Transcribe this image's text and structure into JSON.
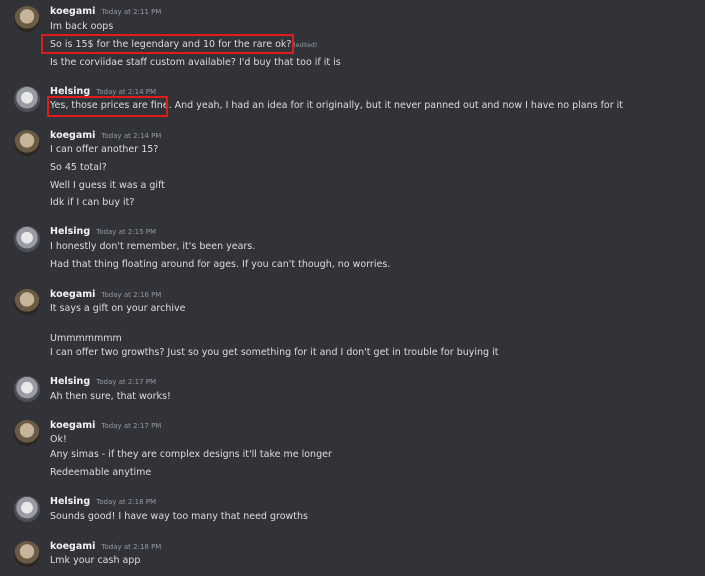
{
  "messages": [
    {
      "author": "koegami",
      "time": "Today at 2:11 PM",
      "lines": [
        "Im back oops",
        "So is 15$ for the legendary and 10 for the rare ok?",
        "Is the corviidae staff custom available? I'd buy that too if it is"
      ],
      "edited_label": "(edited)"
    },
    {
      "author": "Helsing",
      "time": "Today at 2:14 PM",
      "lines": [
        "Yes, those prices are fine.",
        "And yeah, I had an idea for it originally, but it never panned out and now I have no plans for it"
      ]
    },
    {
      "author": "koegami",
      "time": "Today at 2:14 PM",
      "lines": [
        "I can offer another 15?",
        "So 45 total?",
        "Well I guess it was a gift",
        "Idk if I can buy it?"
      ]
    },
    {
      "author": "Helsing",
      "time": "Today at 2:15 PM",
      "lines": [
        "I honestly don't remember, it's been years.",
        "Had that thing floating around for ages. If you can't though, no worries."
      ]
    },
    {
      "author": "koegami",
      "time": "Today at 2:16 PM",
      "lines": [
        "It says a gift on your archive",
        "Ummmmmmm",
        "I can offer two growths? Just so you get something for it and I don't get in trouble for buying it"
      ]
    },
    {
      "author": "Helsing",
      "time": "Today at 2:17 PM",
      "lines": [
        "Ah then sure, that works!"
      ]
    },
    {
      "author": "koegami",
      "time": "Today at 2:17 PM",
      "lines": [
        "Ok!",
        "Any simas - if they are complex designs it'll take me longer",
        "Redeemable anytime"
      ]
    },
    {
      "author": "Helsing",
      "time": "Today at 2:18 PM",
      "lines": [
        "Sounds good! I have way too many that need growths"
      ]
    },
    {
      "author": "koegami",
      "time": "Today at 2:18 PM",
      "lines": [
        "Lmk your cash app"
      ]
    }
  ]
}
